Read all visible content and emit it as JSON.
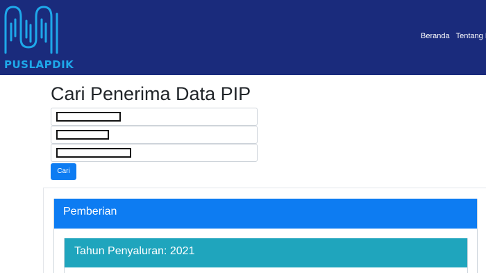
{
  "header": {
    "logo_text": "PUSLAPDIK",
    "nav_items": [
      "Beranda",
      "Tentang I"
    ]
  },
  "search": {
    "title": "Cari Penerima Data PIP",
    "fields": [
      {
        "value": "",
        "note": "redacted"
      },
      {
        "value": "",
        "note": "redacted"
      },
      {
        "value": "",
        "note": "redacted"
      }
    ],
    "button_label": "Cari"
  },
  "results": {
    "section_title": "Pemberian",
    "subsection_title": "Tahun Penyaluran: 2021"
  },
  "colors": {
    "navbar": "#1a2b7c",
    "primary": "#0d7cf2",
    "info": "#1fa5bd",
    "logo": "#1ea8ea"
  },
  "icons": [
    "puslapdik-logo-icon"
  ]
}
